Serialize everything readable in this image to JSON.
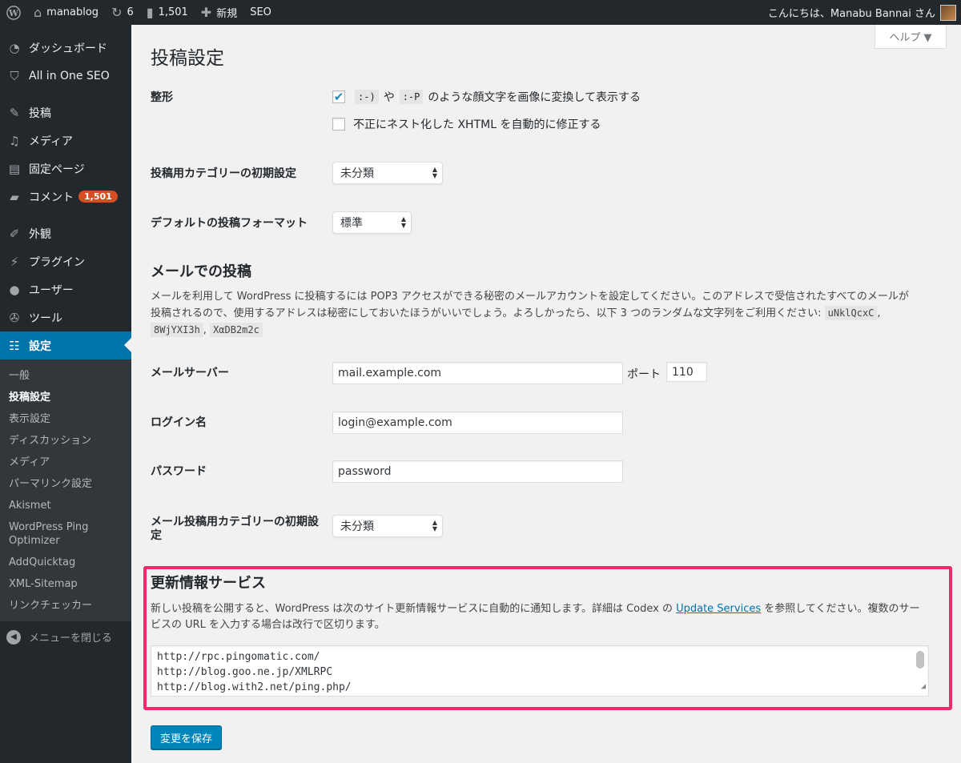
{
  "adminbar": {
    "site_name": "manablog",
    "updates_count": "6",
    "comments_count": "1,501",
    "new_label": "新規",
    "seo_label": "SEO",
    "greeting": "こんにちは、Manabu Bannai さん"
  },
  "sidebar": {
    "items": [
      {
        "label": "ダッシュボード",
        "icon": "dashboard-icon"
      },
      {
        "label": "All in One SEO",
        "icon": "shield-icon"
      },
      {
        "label": "投稿",
        "icon": "pin-icon"
      },
      {
        "label": "メディア",
        "icon": "media-icon"
      },
      {
        "label": "固定ページ",
        "icon": "page-icon"
      },
      {
        "label": "コメント",
        "icon": "comment-icon",
        "badge": "1,501"
      },
      {
        "label": "外観",
        "icon": "brush-icon"
      },
      {
        "label": "プラグイン",
        "icon": "plugin-icon"
      },
      {
        "label": "ユーザー",
        "icon": "user-icon"
      },
      {
        "label": "ツール",
        "icon": "wrench-icon"
      },
      {
        "label": "設定",
        "icon": "settings-icon"
      }
    ],
    "submenu": [
      "一般",
      "投稿設定",
      "表示設定",
      "ディスカッション",
      "メディア",
      "パーマリンク設定",
      "Akismet",
      "WordPress Ping Optimizer",
      "AddQuicktag",
      "XML-Sitemap",
      "リンクチェッカー"
    ],
    "collapse_label": "メニューを閉じる"
  },
  "help_label": "ヘルプ ▼",
  "page_title": "投稿設定",
  "formatting": {
    "label": "整形",
    "option1_code1": ":-)",
    "option1_mid": "や",
    "option1_code2": ":-P",
    "option1_text": "のような顔文字を画像に変換して表示する",
    "option1_checked": true,
    "option2_text": "不正にネスト化した XHTML を自動的に修正する",
    "option2_checked": false
  },
  "default_category": {
    "label": "投稿用カテゴリーの初期設定",
    "value": "未分類"
  },
  "default_format": {
    "label": "デフォルトの投稿フォーマット",
    "value": "標準"
  },
  "post_via_email": {
    "title": "メールでの投稿",
    "desc_line1": "メールを利用して WordPress に投稿するには POP3 アクセスができる秘密のメールアカウントを設定してください。このアドレスで受信されたすべてのメールが",
    "desc_line2": "投稿されるので、使用するアドレスは秘密にしておいたほうがいいでしょう。よろしかったら、以下 3 つのランダムな文字列をご利用ください:",
    "code1": "uNklQcxC",
    "code2": "8WjYXI3h",
    "code3": "XαDB2m2c",
    "server_label": "メールサーバー",
    "server_value": "mail.example.com",
    "port_label": "ポート",
    "port_value": "110",
    "login_label": "ログイン名",
    "login_value": "login@example.com",
    "password_label": "パスワード",
    "password_value": "password",
    "category_label": "メール投稿用カテゴリーの初期設定",
    "category_value": "未分類"
  },
  "update_services": {
    "title": "更新情報サービス",
    "desc_part1": "新しい投稿を公開すると、WordPress は次のサイト更新情報サービスに自動的に通知します。詳細は Codex の",
    "link_text": "Update Services",
    "desc_part2": "を参照してください。複数のサー",
    "desc_line2": "ビスの URL を入力する場合は改行で区切ります。",
    "urls": [
      "http://rpc.pingomatic.com/",
      "http://blog.goo.ne.jp/XMLRPC",
      "http://blog.with2.net/ping.php/"
    ]
  },
  "save_button": "変更を保存"
}
